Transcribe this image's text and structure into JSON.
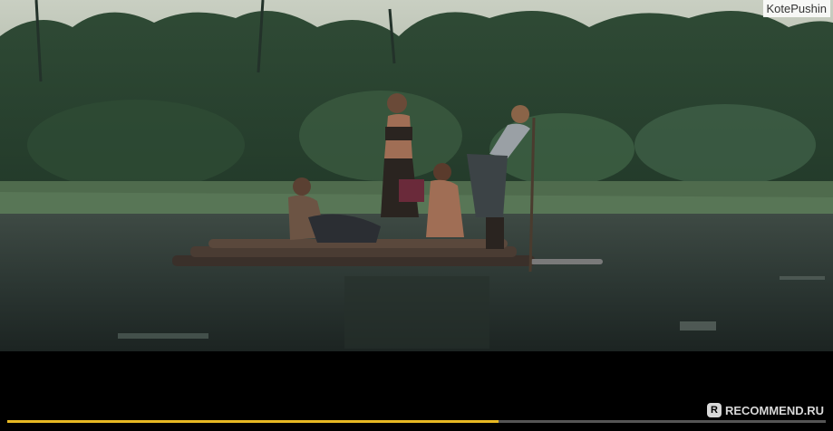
{
  "watermark_top": "KotePushin",
  "watermark_bottom": "RECOMMEND.RU",
  "watermark_bottom_icon": "r-logo-icon",
  "video": {
    "progress_fraction": 0.6
  },
  "colors": {
    "progress": "#e8b923",
    "track": "#555555"
  }
}
